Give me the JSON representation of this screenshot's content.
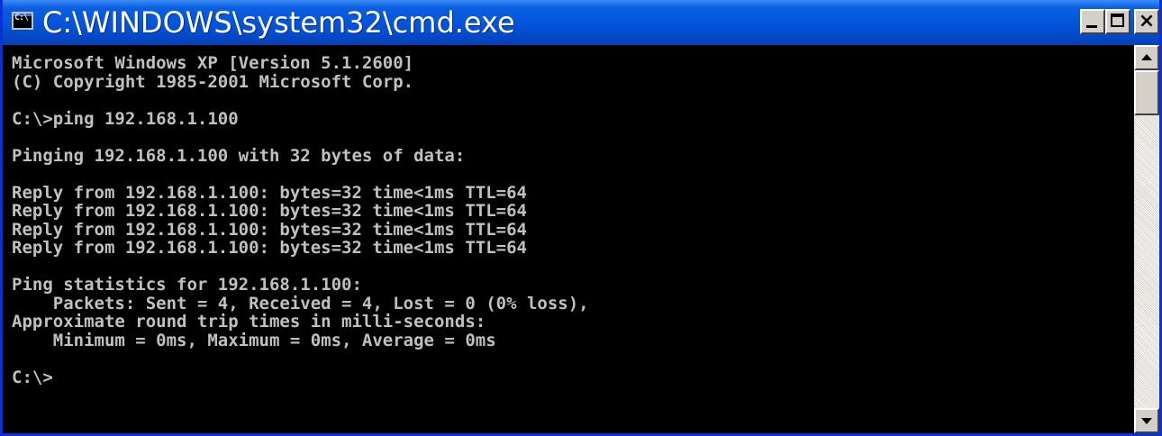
{
  "window": {
    "title": "C:\\WINDOWS\\system32\\cmd.exe",
    "icon": "cmd-icon",
    "icon_glyph": "C:\\"
  },
  "title_buttons": {
    "minimize": "minimize-icon",
    "maximize": "maximize-icon",
    "close": "close-icon",
    "close_glyph": "×"
  },
  "console": {
    "lines": [
      "Microsoft Windows XP [Version 5.1.2600]",
      "(C) Copyright 1985-2001 Microsoft Corp.",
      "",
      "C:\\>ping 192.168.1.100",
      "",
      "Pinging 192.168.1.100 with 32 bytes of data:",
      "",
      "Reply from 192.168.1.100: bytes=32 time<1ms TTL=64",
      "Reply from 192.168.1.100: bytes=32 time<1ms TTL=64",
      "Reply from 192.168.1.100: bytes=32 time<1ms TTL=64",
      "Reply from 192.168.1.100: bytes=32 time<1ms TTL=64",
      "",
      "Ping statistics for 192.168.1.100:",
      "    Packets: Sent = 4, Received = 4, Lost = 0 (0% loss),",
      "Approximate round trip times in milli-seconds:",
      "    Minimum = 0ms, Maximum = 0ms, Average = 0ms",
      "",
      "C:\\>"
    ],
    "text_color": "#c0c0c0",
    "background_color": "#000000"
  },
  "scrollbar": {
    "up_icon": "scroll-up-arrow-icon",
    "down_icon": "scroll-down-arrow-icon"
  }
}
